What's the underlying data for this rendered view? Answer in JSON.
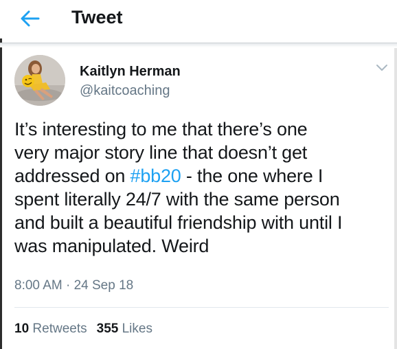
{
  "header": {
    "title": "Tweet",
    "back_icon": "arrow-left-icon",
    "accent": "#1da1f2"
  },
  "tweet": {
    "author": {
      "name": "Kaitlyn Herman",
      "handle": "@kaitcoaching",
      "avatar_icon": "profile-photo"
    },
    "menu_icon": "chevron-down-icon",
    "lines": [
      {
        "pre": "It’s interesting to me that there’s one",
        "tag": "",
        "post": ""
      },
      {
        "pre": "very major story line that doesn’t get",
        "tag": "",
        "post": ""
      },
      {
        "pre": "addressed on ",
        "tag": "#bb20",
        "post": " - the one where I"
      },
      {
        "pre": "spent literally 24/7 with the same person",
        "tag": "",
        "post": ""
      },
      {
        "pre": "and built a beautiful friendship with until I",
        "tag": "",
        "post": ""
      },
      {
        "pre": "was manipulated. Weird",
        "tag": "",
        "post": ""
      }
    ],
    "timestamp": "8:00 AM · 24 Sep 18",
    "stats": {
      "retweets_count": "10",
      "retweets_label": "Retweets",
      "likes_count": "355",
      "likes_label": "Likes"
    }
  },
  "colors": {
    "text": "#14171a",
    "secondary": "#657786",
    "link": "#1da1f2",
    "divider": "#e1e8ed"
  }
}
